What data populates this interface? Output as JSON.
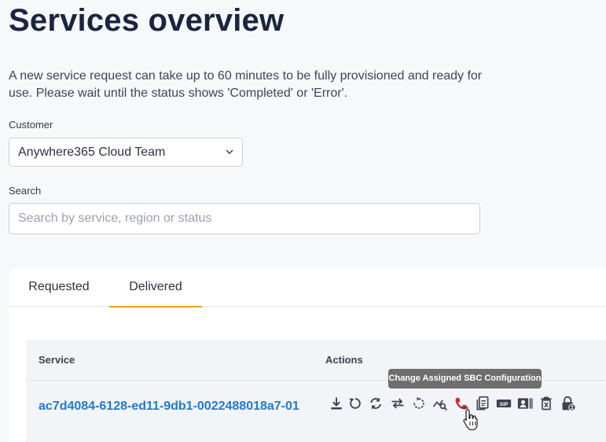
{
  "page": {
    "title": "Services overview",
    "intro": "A new service request can take up to 60 minutes to be fully provisioned and ready for use. Please wait until the status shows 'Completed' or 'Error'."
  },
  "customer": {
    "label": "Customer",
    "selected": "Anywhere365 Cloud Team"
  },
  "search": {
    "label": "Search",
    "placeholder": "Search by service, region or status",
    "value": ""
  },
  "tabs": [
    {
      "label": "Requested",
      "active": false
    },
    {
      "label": "Delivered",
      "active": true
    }
  ],
  "table": {
    "headers": {
      "service": "Service",
      "actions": "Actions"
    },
    "rows": [
      {
        "service": "ac7d4084-6128-ed11-9db1-0022488018a7-01"
      }
    ]
  },
  "actions": [
    "download-icon",
    "restart-icon",
    "sync-icon",
    "swap-icon",
    "reset-icon",
    "analytics-search-icon",
    "phone-config-icon",
    "copy-document-icon",
    "sip-icon",
    "contact-card-icon",
    "delete-icon",
    "lock-account-icon"
  ],
  "tooltip": {
    "text": "Change Assigned SBC Configuration"
  },
  "colors": {
    "accent_tab": "#f0a500",
    "link": "#1f7ad6",
    "icon": "#3d4350",
    "icon_active": "#d9232e",
    "tooltip_bg": "#6e6e6e"
  }
}
